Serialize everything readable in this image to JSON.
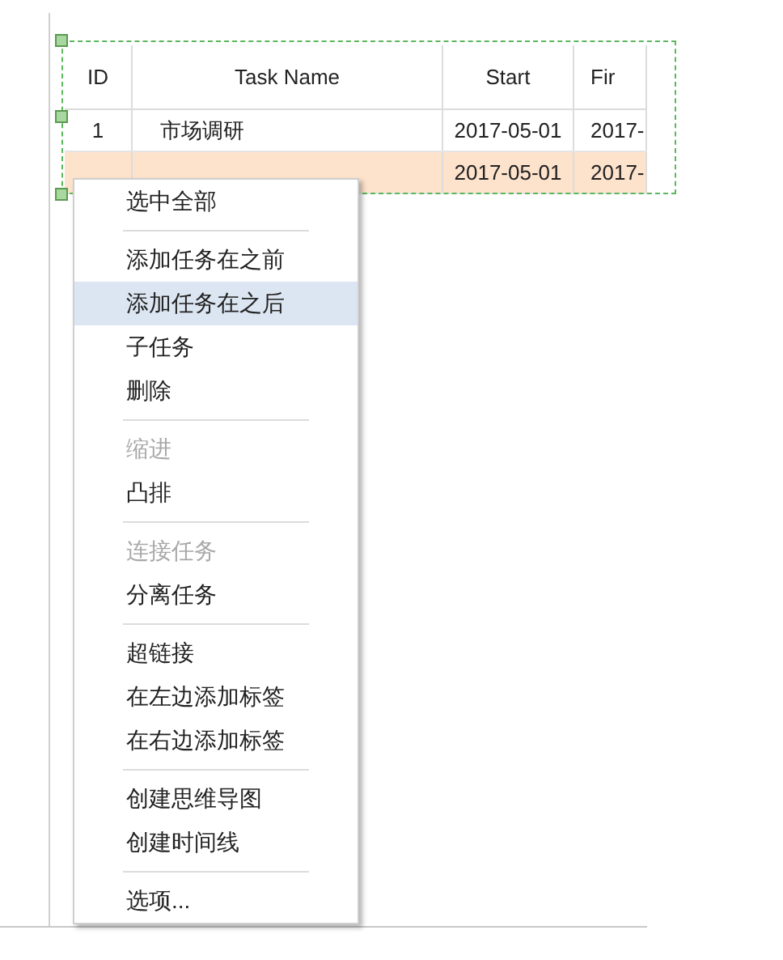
{
  "table": {
    "columns": [
      "ID",
      "Task Name",
      "Start",
      "Fir"
    ],
    "rows": [
      {
        "cells": [
          "1",
          "市场调研",
          "2017-05-01",
          "2017-"
        ],
        "selected": false
      },
      {
        "cells": [
          "",
          "",
          "2017-05-01",
          "2017-"
        ],
        "selected": true
      }
    ]
  },
  "context_menu": {
    "groups": [
      [
        {
          "label": "选中全部",
          "disabled": false,
          "selected": false
        }
      ],
      [
        {
          "label": "添加任务在之前",
          "disabled": false,
          "selected": false
        },
        {
          "label": "添加任务在之后",
          "disabled": false,
          "selected": true
        },
        {
          "label": "子任务",
          "disabled": false,
          "selected": false
        },
        {
          "label": "删除",
          "disabled": false,
          "selected": false
        }
      ],
      [
        {
          "label": "缩进",
          "disabled": true,
          "selected": false
        },
        {
          "label": "凸排",
          "disabled": false,
          "selected": false
        }
      ],
      [
        {
          "label": "连接任务",
          "disabled": true,
          "selected": false
        },
        {
          "label": "分离任务",
          "disabled": false,
          "selected": false
        }
      ],
      [
        {
          "label": "超链接",
          "disabled": false,
          "selected": false
        },
        {
          "label": "在左边添加标签",
          "disabled": false,
          "selected": false
        },
        {
          "label": "在右边添加标签",
          "disabled": false,
          "selected": false
        }
      ],
      [
        {
          "label": "创建思维导图",
          "disabled": false,
          "selected": false
        },
        {
          "label": "创建时间线",
          "disabled": false,
          "selected": false
        }
      ],
      [
        {
          "label": "选项...",
          "disabled": false,
          "selected": false
        }
      ]
    ]
  }
}
